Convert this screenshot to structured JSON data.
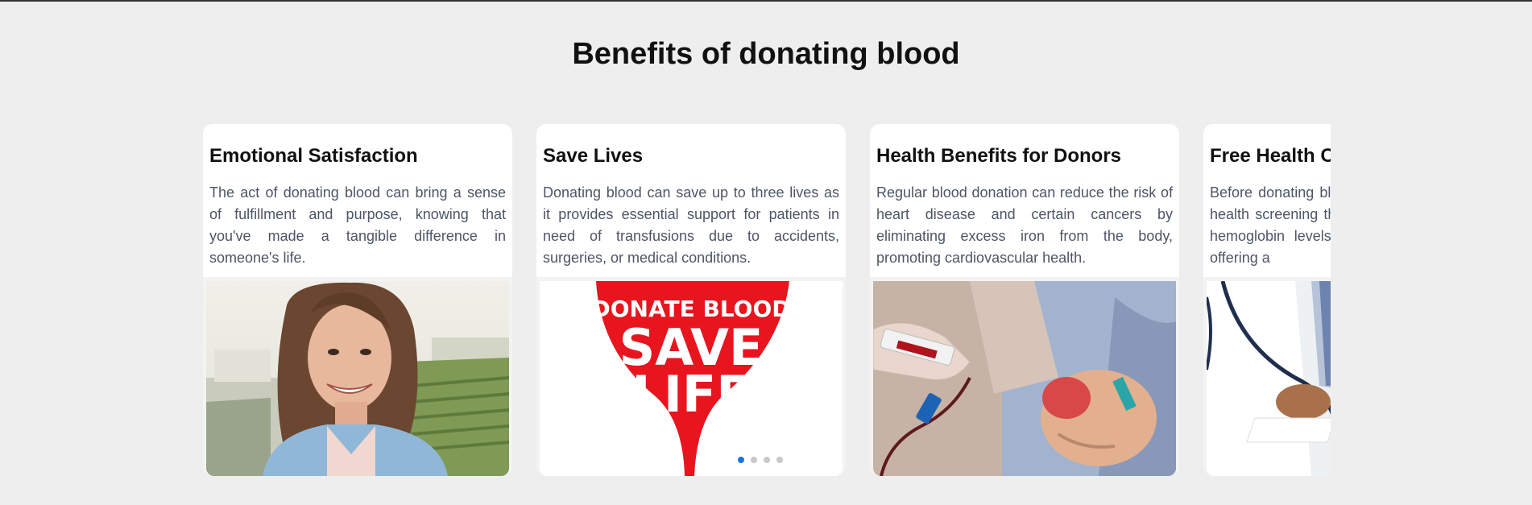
{
  "section": {
    "title": "Benefits of donating blood"
  },
  "cards": [
    {
      "title": "Emotional Satisfaction",
      "text": "The act of donating blood can bring a sense of fulfillment and purpose, knowing that you've made a tangible difference in someone's life.",
      "image": "smiling-woman-photo"
    },
    {
      "title": "Save Lives",
      "text": "Donating blood can save up to three lives as it provides essential support for patients in need of transfusions due to accidents, surgeries, or medical conditions.",
      "image": "donate-blood-heart-poster",
      "poster_line1": "DONATE BLOOD",
      "poster_line2": "SAVE",
      "poster_line3": "LIFE"
    },
    {
      "title": "Health Benefits for Donors",
      "text": "Regular blood donation can reduce the risk of heart disease and certain cancers by eliminating excess iron from the body, promoting cardiovascular health.",
      "image": "blood-draw-photo"
    },
    {
      "title": "Free Health Checkup",
      "text": "Before donating blood, donors receive a free health screening that checks blood pressure, hemoglobin levels and infectious diseases, offering a",
      "image": "doctor-stethoscope-photo"
    }
  ],
  "pagination": {
    "count": 4,
    "active": 0
  },
  "colors": {
    "background": "#eeeeee",
    "accent": "#1a73e8",
    "poster_red": "#e8141e",
    "body_text": "#4d5566"
  }
}
